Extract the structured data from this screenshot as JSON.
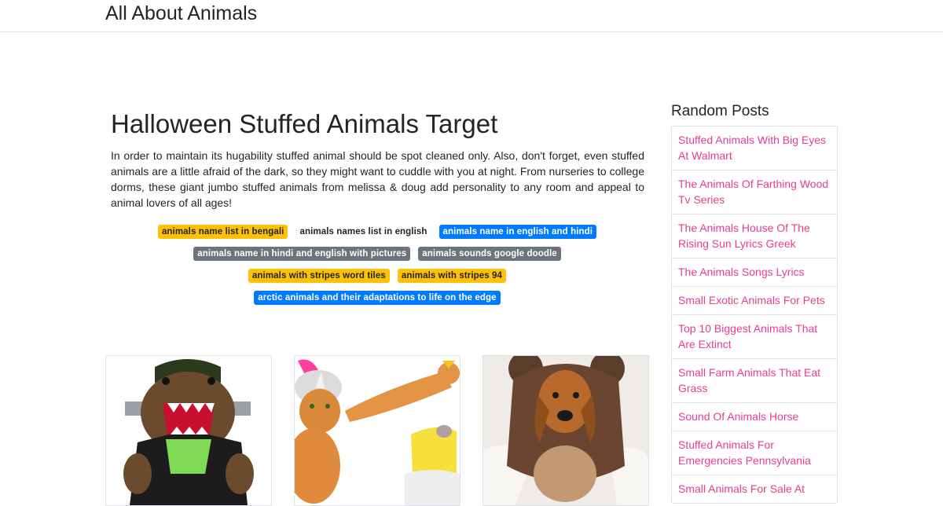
{
  "site": {
    "brand": "All About Animals"
  },
  "post": {
    "title": "Halloween Stuffed Animals Target",
    "intro": "In order to maintain its hugability stuffed animal should be spot cleaned only. Also, don't forget, even stuffed animals are a little afraid of the dark, so they might want to cuddle with you at night. From nurseries to college dorms, these giant jumbo stuffed animals from melissa & doug add personality to any room and appeal to animal lovers of all ages!"
  },
  "tags": [
    [
      {
        "label": "animals name list in bengali",
        "style": "warning"
      },
      {
        "label": "animals names list in english",
        "style": "light"
      },
      {
        "label": "animals name in english and hindi",
        "style": "primary"
      }
    ],
    [
      {
        "label": "animals name in hindi and english with pictures",
        "style": "secondary"
      },
      {
        "label": "animals sounds google doodle",
        "style": "secondary"
      }
    ],
    [
      {
        "label": "animals with stripes word tiles",
        "style": "warning"
      },
      {
        "label": "animals with stripes 94",
        "style": "warning"
      }
    ],
    [
      {
        "label": "arctic animals and their adaptations to life on the edge",
        "style": "primary"
      }
    ]
  ],
  "thumbnails": [
    {
      "icon": "frankenstein-plush-image"
    },
    {
      "icon": "costumed-cats-image"
    },
    {
      "icon": "dog-in-bear-costume-image"
    }
  ],
  "sidebar": {
    "title": "Random Posts",
    "items": [
      {
        "label": "Stuffed Animals With Big Eyes At Walmart"
      },
      {
        "label": "The Animals Of Farthing Wood Tv Series"
      },
      {
        "label": "The Animals House Of The Rising Sun Lyrics Greek"
      },
      {
        "label": "The Animals Songs Lyrics"
      },
      {
        "label": "Small Exotic Animals For Pets"
      },
      {
        "label": "Top 10 Biggest Animals That Are Extinct"
      },
      {
        "label": "Small Farm Animals That Eat Grass"
      },
      {
        "label": "Sound Of Animals Horse"
      },
      {
        "label": "Stuffed Animals For Emergencies Pennsylvania"
      },
      {
        "label": "Small Animals For Sale At"
      }
    ]
  },
  "colors": {
    "link_pink": "#e83e8c",
    "badge_warning": "#ffc107",
    "badge_primary": "#007bff",
    "badge_secondary": "#6c757d",
    "border": "#dee2e6"
  }
}
